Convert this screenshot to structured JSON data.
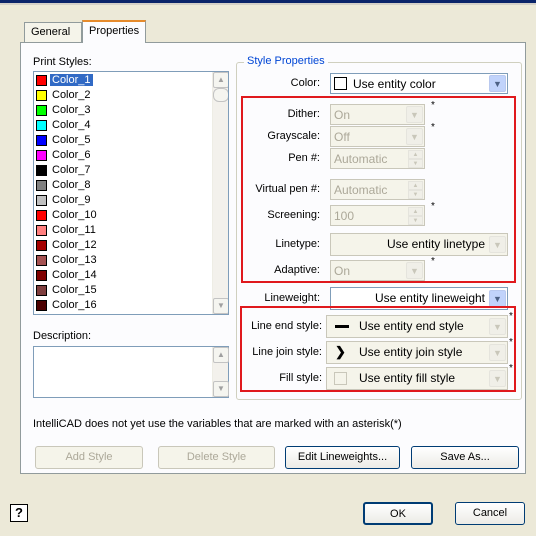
{
  "tabs": [
    "General",
    "Properties"
  ],
  "print_styles_label": "Print Styles:",
  "print_styles": [
    {
      "name": "Color_1",
      "color": "#ff0000",
      "selected": true
    },
    {
      "name": "Color_2",
      "color": "#ffff00"
    },
    {
      "name": "Color_3",
      "color": "#00ff00"
    },
    {
      "name": "Color_4",
      "color": "#00ffff"
    },
    {
      "name": "Color_5",
      "color": "#0000ff"
    },
    {
      "name": "Color_6",
      "color": "#ff00ff"
    },
    {
      "name": "Color_7",
      "color": "#000000"
    },
    {
      "name": "Color_8",
      "color": "#808080"
    },
    {
      "name": "Color_9",
      "color": "#c0c0c0"
    },
    {
      "name": "Color_10",
      "color": "#ff0000"
    },
    {
      "name": "Color_11",
      "color": "#ff7f7f"
    },
    {
      "name": "Color_12",
      "color": "#a50000"
    },
    {
      "name": "Color_13",
      "color": "#a55252"
    },
    {
      "name": "Color_14",
      "color": "#7f0000"
    },
    {
      "name": "Color_15",
      "color": "#7f3f3f"
    },
    {
      "name": "Color_16",
      "color": "#4c0000"
    }
  ],
  "description_label": "Description:",
  "style_properties_title": "Style Properties",
  "props": {
    "color_label": "Color:",
    "color_value": "Use entity color",
    "dither_label": "Dither:",
    "dither_value": "On",
    "grayscale_label": "Grayscale:",
    "grayscale_value": "Off",
    "pen_label": "Pen #:",
    "pen_value": "Automatic",
    "virtual_pen_label": "Virtual pen #:",
    "virtual_pen_value": "Automatic",
    "screening_label": "Screening:",
    "screening_value": "100",
    "linetype_label": "Linetype:",
    "linetype_value": "Use entity linetype",
    "adaptive_label": "Adaptive:",
    "adaptive_value": "On",
    "lineweight_label": "Lineweight:",
    "lineweight_value": "Use entity lineweight",
    "line_end_label": "Line end style:",
    "line_end_value": "Use entity end style",
    "line_join_label": "Line join style:",
    "line_join_value": "Use entity join style",
    "fill_label": "Fill style:",
    "fill_value": "Use entity fill style"
  },
  "asterisk": "*",
  "note": "IntelliCAD does not yet use the variables that are marked with an asterisk(*)",
  "buttons": {
    "add_style": "Add Style",
    "delete_style": "Delete Style",
    "edit_lineweights": "Edit Lineweights...",
    "save_as": "Save As...",
    "ok": "OK",
    "cancel": "Cancel",
    "help": "?"
  }
}
